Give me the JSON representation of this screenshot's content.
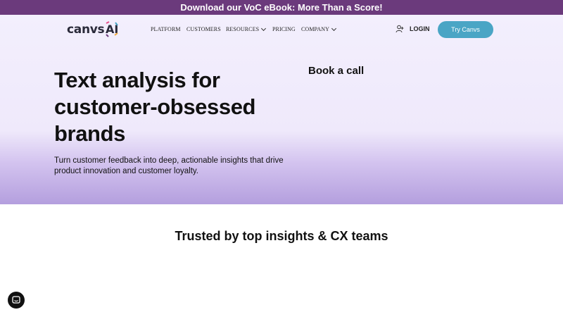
{
  "banner": {
    "text": "Download our VoC eBook: More Than a Score!"
  },
  "logo": {
    "text": "canvs",
    "suffix": "AI"
  },
  "nav": {
    "items": [
      {
        "label": "PLATFORM",
        "has_dropdown": false
      },
      {
        "label": "CUSTOMERS",
        "has_dropdown": false
      },
      {
        "label": "RESOURCES",
        "has_dropdown": true
      },
      {
        "label": "PRICING",
        "has_dropdown": false
      },
      {
        "label": "COMPANY",
        "has_dropdown": true
      }
    ],
    "login_label": "LOGIN",
    "cta_label": "Try Canvs",
    "user_icon": "user-plus-icon"
  },
  "hero": {
    "headline": "Text analysis for customer-obsessed brands",
    "subtext": "Turn customer feedback into deep, actionable insights that drive product innovation and customer loyalty.",
    "book_call": "Book a call"
  },
  "trusted": {
    "heading": "Trusted by top insights & CX teams"
  },
  "chat": {
    "icon": "chat-icon"
  },
  "colors": {
    "banner_bg": "#6b3a7c",
    "cta_bg": "#4aa5c5",
    "hero_top": "#f3effd",
    "hero_bottom": "#b49fde"
  }
}
